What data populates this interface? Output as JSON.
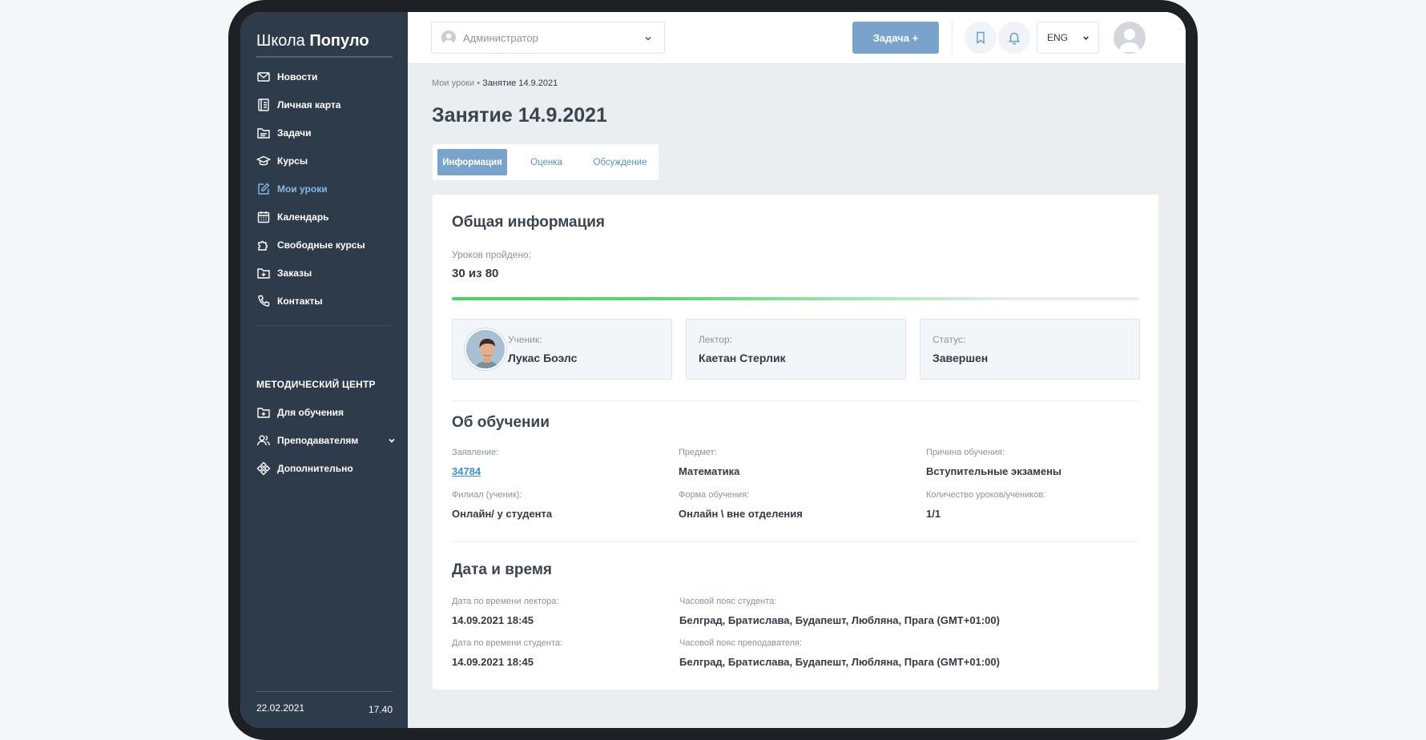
{
  "sidebar": {
    "logo_regular": "Школа",
    "logo_bold": "Популо",
    "items": [
      {
        "label": "Новости",
        "icon": "mail-icon"
      },
      {
        "label": "Личная карта",
        "icon": "id-card-icon"
      },
      {
        "label": "Задачи",
        "icon": "folder-icon"
      },
      {
        "label": "Курсы",
        "icon": "graduation-cap-icon"
      },
      {
        "label": "Мои уроки",
        "icon": "edit-icon",
        "active": true
      },
      {
        "label": "Календарь",
        "icon": "calendar-icon"
      },
      {
        "label": "Свободные курсы",
        "icon": "puzzle-icon"
      },
      {
        "label": "Заказы",
        "icon": "folder-plus-icon"
      },
      {
        "label": "Контакты",
        "icon": "phone-icon"
      }
    ],
    "section_title": "МЕТОДИЧЕСКИЙ ЦЕНТР",
    "section_items": [
      {
        "label": "Для обучения",
        "icon": "folder-plus-icon"
      },
      {
        "label": "Преподавателям",
        "icon": "users-icon",
        "has_dropdown": true
      },
      {
        "label": "Дополнительно",
        "icon": "diamond-grid-icon"
      }
    ],
    "date": "22.02.2021",
    "time": "17.40"
  },
  "topbar": {
    "role": "Администратор",
    "task_button": "Задача +",
    "language": "ENG"
  },
  "breadcrumb": {
    "parent": "Мои уроки",
    "separator": "•",
    "current": "Занятие 14.9.2021"
  },
  "page_title": "Занятие 14.9.2021",
  "tabs": [
    {
      "label": "Информация",
      "active": true
    },
    {
      "label": "Оценка"
    },
    {
      "label": "Обсуждение"
    }
  ],
  "general": {
    "title": "Общая информация",
    "lessons_label": "Уроков пройдено:",
    "lessons_value": "30 из 80",
    "progress_fraction": 0.375,
    "student_label": "Ученик:",
    "student_name": "Лукас Боэлс",
    "lecturer_label": "Лектор:",
    "lecturer_name": "Каетан Стерлик",
    "status_label": "Статус:",
    "status_value": "Завершен"
  },
  "about": {
    "title": "Об обучении",
    "application_label": "Заявление:",
    "application_value": "34784",
    "subject_label": "Предмет:",
    "subject_value": "Математика",
    "reason_label": "Причина обучения:",
    "reason_value": "Вступительные экзамены",
    "branch_label": "Филиал (ученик):",
    "branch_value": "Онлайн/ у студента",
    "form_label": "Форма обучения:",
    "form_value": "Онлайн \\ вне отделения",
    "count_label": "Количество уроков/учеников:",
    "count_value": "1/1"
  },
  "datetime": {
    "title": "Дата и время",
    "lecturer_date_label": "Дата по времени лектора:",
    "lecturer_date_value": "14.09.2021 18:45",
    "student_tz_label": "Часовой пояс студента:",
    "student_tz_value": "Белград, Братислава, Будапешт, Любляна, Прага (GMT+01:00)",
    "student_date_label": "Дата по времени студента:",
    "student_date_value": "14.09.2021 18:45",
    "teacher_tz_label": "Часовой пояс преподавателя:",
    "teacher_tz_value": "Белград, Братислава, Будапешт, Любляна, Прага (GMT+01:00)"
  },
  "colors": {
    "sidebar_bg": "#2e3b4b",
    "accent": "#7aa3cc",
    "active_nav": "#8ab7e6",
    "link": "#3d8fd6",
    "progress": "#4bd164"
  }
}
